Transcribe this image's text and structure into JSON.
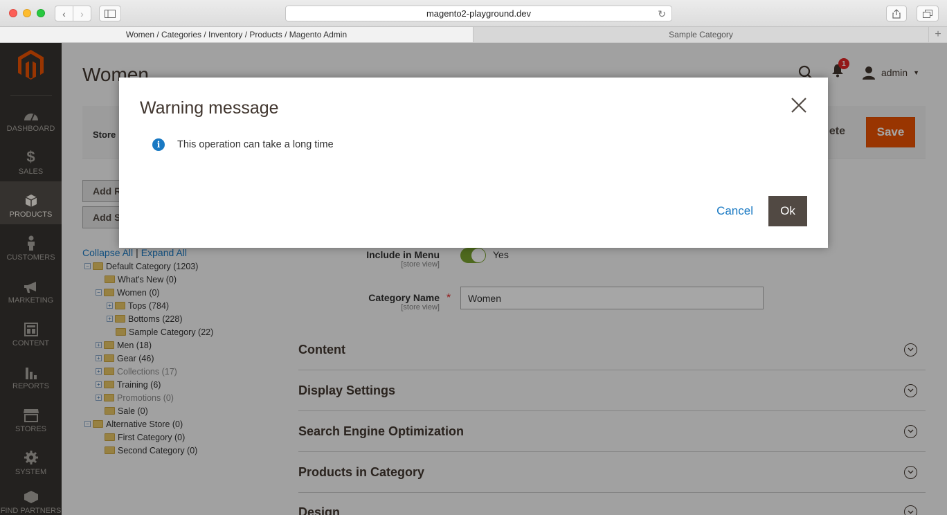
{
  "browser": {
    "url": "magento2-playground.dev",
    "tabs": [
      {
        "label": "Women / Categories / Inventory / Products / Magento Admin"
      },
      {
        "label": "Sample Category"
      }
    ]
  },
  "menu": {
    "items": [
      {
        "label": "DASHBOARD"
      },
      {
        "label": "SALES"
      },
      {
        "label": "PRODUCTS"
      },
      {
        "label": "CUSTOMERS"
      },
      {
        "label": "MARKETING"
      },
      {
        "label": "CONTENT"
      },
      {
        "label": "REPORTS"
      },
      {
        "label": "STORES"
      },
      {
        "label": "SYSTEM"
      },
      {
        "label": "FIND PARTNERS"
      }
    ]
  },
  "header": {
    "title": "Women",
    "notification_count": "1",
    "user": "admin"
  },
  "actions": {
    "store_label": "Store",
    "delete_label": "ete",
    "save_label": "Save",
    "add_root_label": "Add R",
    "add_sub_label": "Add S"
  },
  "tree": {
    "collapse_all": "Collapse All",
    "separator": "|",
    "expand_all": "Expand All",
    "nodes": [
      {
        "label": "Default Category (1203)"
      },
      {
        "label": "What's New (0)"
      },
      {
        "label": "Women (0)"
      },
      {
        "label": "Tops (784)"
      },
      {
        "label": "Bottoms (228)"
      },
      {
        "label": "Sample Category (22)"
      },
      {
        "label": "Men (18)"
      },
      {
        "label": "Gear (46)"
      },
      {
        "label": "Collections (17)"
      },
      {
        "label": "Training (6)"
      },
      {
        "label": "Promotions (0)"
      },
      {
        "label": "Sale (0)"
      },
      {
        "label": "Alternative Store (0)"
      },
      {
        "label": "First Category (0)"
      },
      {
        "label": "Second Category (0)"
      }
    ]
  },
  "form": {
    "include_in_menu_label": "Include in Menu",
    "include_in_menu_scope": "[store view]",
    "include_in_menu_value": "Yes",
    "category_name_label": "Category Name",
    "category_name_scope": "[store view]",
    "required_mark": "*",
    "category_name_value": "Women"
  },
  "sections": [
    {
      "title": "Content"
    },
    {
      "title": "Display Settings"
    },
    {
      "title": "Search Engine Optimization"
    },
    {
      "title": "Products in Category"
    },
    {
      "title": "Design"
    }
  ],
  "modal": {
    "title": "Warning message",
    "message": "This operation can take a long time",
    "cancel_label": "Cancel",
    "ok_label": "Ok"
  },
  "colors": {
    "accent": "#eb5202",
    "link": "#1979c3",
    "sidebar": "#373330",
    "ok_button": "#514943"
  }
}
